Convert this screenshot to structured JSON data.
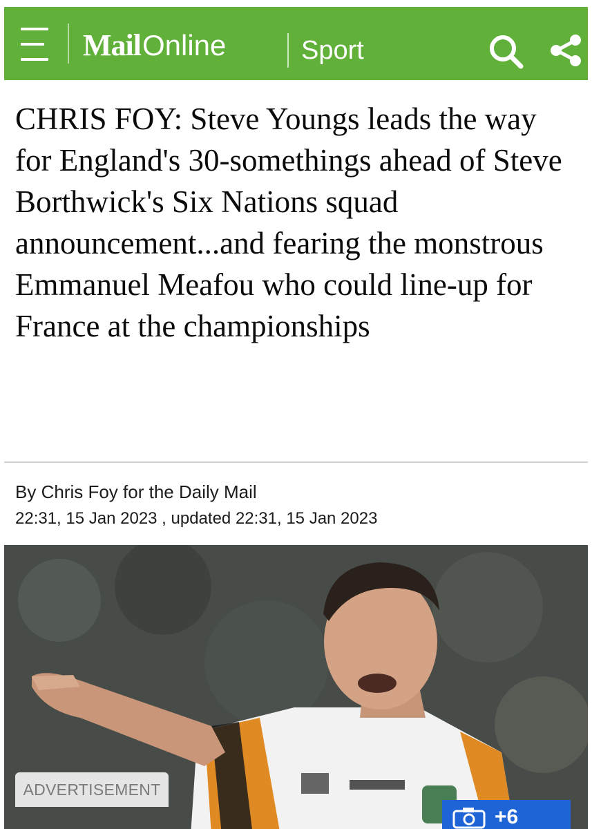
{
  "header": {
    "brand_mail": "Mail",
    "brand_online": "Online",
    "section": "Sport",
    "background_color": "#61b03a",
    "icons": [
      "menu-icon",
      "search-icon",
      "share-icon"
    ]
  },
  "article": {
    "headline": "CHRIS FOY: Steve Youngs leads the way for England's 30-somethings ahead of Steve Borthwick's Six Nations squad announcement...and fearing the monstrous Emmanuel Meafou who could line-up for France at the championships",
    "byline": "By Chris Foy for the Daily Mail",
    "published": "22:31, 15 Jan 2023 , updated 22:31, 15 Jan 2023"
  },
  "media": {
    "advertisement_label": "ADVERTISEMENT",
    "gallery_count": "+6",
    "gallery_color": "#1f64d6"
  }
}
